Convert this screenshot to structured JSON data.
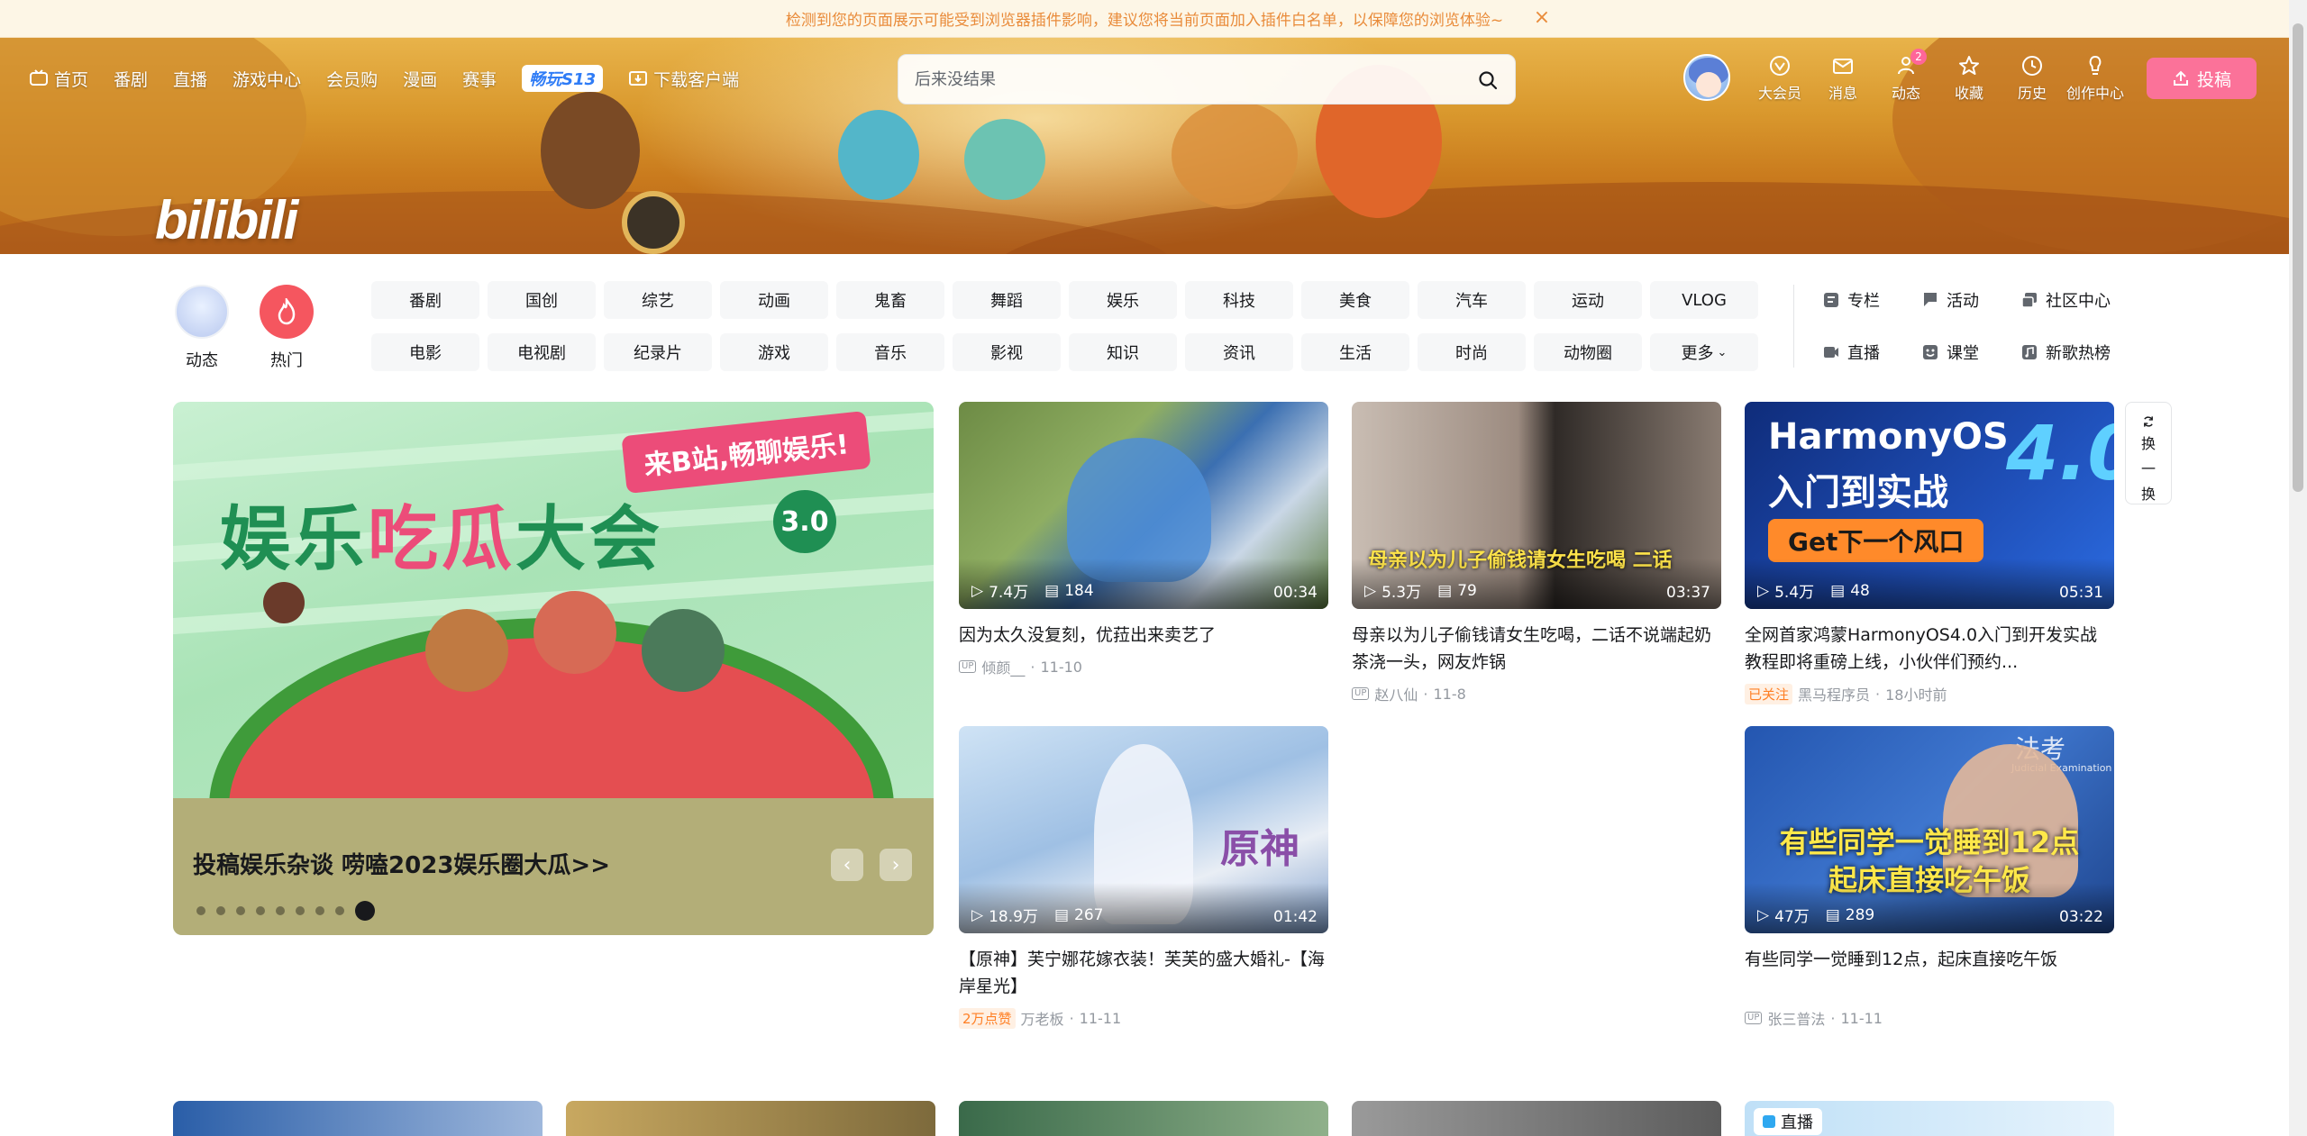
{
  "notice": {
    "text": "检测到您的页面展示可能受到浏览器插件影响，建议您将当前页面加入插件白名单，以保障您的浏览体验~"
  },
  "nav": {
    "items": [
      {
        "label": "首页",
        "icon": "tv-icon"
      },
      {
        "label": "番剧"
      },
      {
        "label": "直播"
      },
      {
        "label": "游戏中心"
      },
      {
        "label": "会员购"
      },
      {
        "label": "漫画"
      },
      {
        "label": "赛事"
      }
    ],
    "game_label": "畅玩S13",
    "download_label": "下载客户端",
    "logo": "bilibili"
  },
  "search": {
    "placeholder": "后来没结果"
  },
  "right_nav": [
    {
      "label": "大会员",
      "icon": "vip-icon"
    },
    {
      "label": "消息",
      "icon": "mail-icon"
    },
    {
      "label": "动态",
      "icon": "dynamic-icon",
      "badge": "2"
    },
    {
      "label": "收藏",
      "icon": "star-icon"
    },
    {
      "label": "历史",
      "icon": "clock-icon"
    },
    {
      "label": "创作中心",
      "icon": "bulb-icon"
    }
  ],
  "upload": {
    "label": "投稿"
  },
  "channels": {
    "dynamic_label": "动态",
    "hot_label": "热门",
    "tags": [
      "番剧",
      "国创",
      "综艺",
      "动画",
      "鬼畜",
      "舞蹈",
      "娱乐",
      "科技",
      "美食",
      "汽车",
      "运动",
      "VLOG",
      "电影",
      "电视剧",
      "纪录片",
      "游戏",
      "音乐",
      "影视",
      "知识",
      "资讯",
      "生活",
      "时尚",
      "动物圈",
      "更多"
    ],
    "links": [
      {
        "label": "专栏",
        "icon": "article-icon"
      },
      {
        "label": "活动",
        "icon": "flag-icon"
      },
      {
        "label": "社区中心",
        "icon": "community-icon"
      },
      {
        "label": "直播",
        "icon": "live-icon"
      },
      {
        "label": "课堂",
        "icon": "class-icon"
      },
      {
        "label": "新歌热榜",
        "icon": "music-icon"
      }
    ]
  },
  "carousel": {
    "caption": "投稿娱乐杂谈 唠嗑2023娱乐圈大瓜>>",
    "headline_a": "娱乐",
    "headline_b": "吃瓜",
    "headline_c": "大会",
    "bubble": "来B站,畅聊娱乐!",
    "version": "3.0",
    "dot_count": 9,
    "active_dot": 8
  },
  "refresh": {
    "label_1": "换",
    "label_2": "一",
    "label_3": "换"
  },
  "videos": [
    {
      "views": "7.4万",
      "danmaku": "184",
      "duration": "00:34",
      "title": "因为太久没复刻，优菈出来卖艺了",
      "author": "倾颜__",
      "date": "11-10",
      "badge": "",
      "color_a": "#3b6fb1",
      "color_b": "#7fa65a"
    },
    {
      "views": "5.3万",
      "danmaku": "79",
      "duration": "03:37",
      "title": "母亲以为儿子偷钱请女生吃喝，二话不说端起奶茶浇一头，网友炸锅",
      "author": "赵八仙",
      "date": "11-8",
      "badge": "",
      "overlay": "母亲以为儿子偷钱请女生吃喝 二话",
      "color_a": "#b8a79a",
      "color_b": "#6e5e55"
    },
    {
      "views": "5.4万",
      "danmaku": "48",
      "duration": "05:31",
      "title": "全网首家鸿蒙HarmonyOS4.0入门到开发实战教程即将重磅上线，小伙伴们预约...",
      "author": "黑马程序员",
      "date": "18小时前",
      "badge": "已关注",
      "thumb_line1": "HarmonyOS",
      "thumb_big": "4.0",
      "thumb_line2": "入门到实战",
      "thumb_btn": "Get下一个风口",
      "color_a": "#1d3c8f",
      "color_b": "#2a5fd0"
    },
    {
      "views": "18.9万",
      "danmaku": "267",
      "duration": "01:42",
      "title": "【原神】芙宁娜花嫁衣装！芙芙的盛大婚礼-【海岸星光】",
      "author": "万老板",
      "date": "11-11",
      "badge": "2万点赞",
      "thumb_text": "原神",
      "color_a": "#9fc4e8",
      "color_b": "#e8eef6"
    },
    {
      "views": "47万",
      "danmaku": "289",
      "duration": "03:22",
      "title": "有些同学一觉睡到12点，起床直接吃午饭",
      "author": "张三普法",
      "date": "11-11",
      "badge": "",
      "thumb_line1": "有些同学一觉睡到12点",
      "thumb_line2": "起床直接吃午饭",
      "thumb_corner": "法考",
      "thumb_corner_sub": "Judicial Examination",
      "color_a": "#1f4fa8",
      "color_b": "#3d72c9"
    }
  ],
  "bottom": {
    "live_label": "直播"
  },
  "colors": {
    "pink": "#fb7299",
    "text": "#18191c",
    "muted": "#9499a0",
    "tag_bg": "#f6f7f8"
  }
}
